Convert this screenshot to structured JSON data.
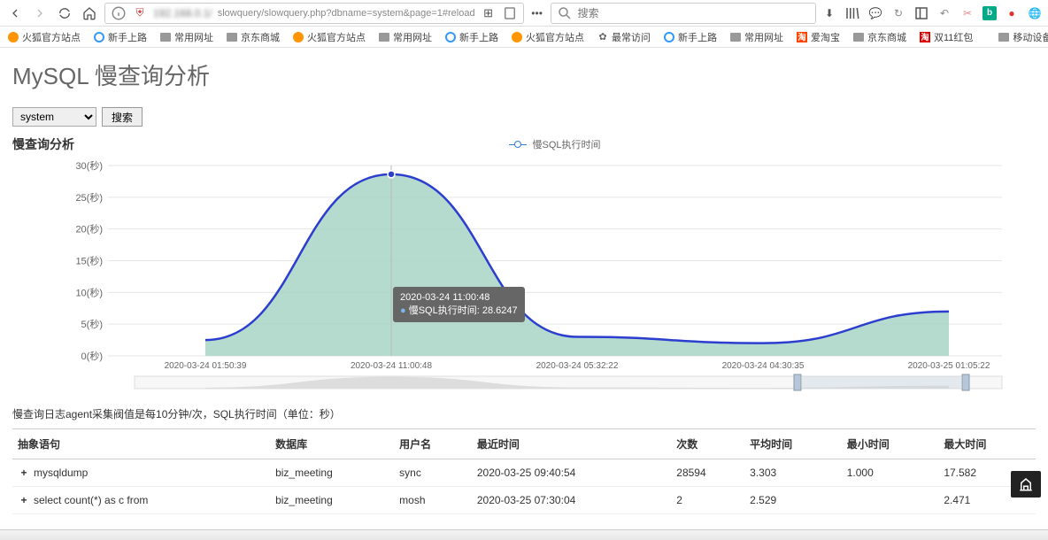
{
  "browser": {
    "url_prefix": "slowquery/slowquery.php?dbname=system&page=1#reload",
    "search_placeholder": "搜索"
  },
  "bookmarks": {
    "items": [
      {
        "label": "火狐官方站点",
        "type": "ff"
      },
      {
        "label": "新手上路",
        "type": "circle"
      },
      {
        "label": "常用网址",
        "type": "folder"
      },
      {
        "label": "京东商城",
        "type": "folder"
      },
      {
        "label": "火狐官方站点",
        "type": "ff"
      },
      {
        "label": "常用网址",
        "type": "folder"
      },
      {
        "label": "新手上路",
        "type": "circle"
      },
      {
        "label": "火狐官方站点",
        "type": "ff"
      },
      {
        "label": "最常访问",
        "type": "gear"
      },
      {
        "label": "新手上路",
        "type": "circle"
      },
      {
        "label": "常用网址",
        "type": "folder"
      },
      {
        "label": "爱淘宝",
        "type": "sq",
        "bg": "#f40"
      },
      {
        "label": "京东商城",
        "type": "folder"
      },
      {
        "label": "双11红包",
        "type": "sq",
        "bg": "#d00"
      }
    ],
    "mobile": "移动设备上的书"
  },
  "page": {
    "title": "MySQL 慢查询分析",
    "db_options": [
      "system"
    ],
    "db_selected": "system",
    "search_btn": "搜索"
  },
  "chart_data": {
    "type": "area",
    "title": "慢查询分析",
    "legend": "慢SQL执行时间",
    "ylabel_suffix": "(秒)",
    "ylim": [
      0,
      30
    ],
    "yticks": [
      0,
      5,
      10,
      15,
      20,
      25,
      30
    ],
    "x": [
      "2020-03-24 01:50:39",
      "2020-03-24 11:00:48",
      "2020-03-24 05:32:22",
      "2020-03-24 04:30:35",
      "2020-03-25 01:05:22"
    ],
    "values_at_ticks": [
      2.5,
      28.6247,
      3,
      2,
      7
    ],
    "tooltip": {
      "time": "2020-03-24 11:00:48",
      "series": "慢SQL执行时间",
      "value": "28.6247"
    }
  },
  "note": "慢查询日志agent采集阀值是每10分钟/次，SQL执行时间（单位：秒）",
  "table": {
    "headers": [
      "抽象语句",
      "数据库",
      "用户名",
      "最近时间",
      "次数",
      "平均时间",
      "最小时间",
      "最大时间"
    ],
    "rows": [
      {
        "expand": "+",
        "sql": "mysqldump",
        "db": "biz_meeting",
        "user": "sync",
        "time": "2020-03-25 09:40:54",
        "count": "28594",
        "avg": "3.303",
        "min": "1.000",
        "max": "17.582"
      },
      {
        "expand": "+",
        "sql": "select count(*) as c from",
        "db": "biz_meeting",
        "user": "mosh",
        "time": "2020-03-25 07:30:04",
        "count": "2",
        "avg": "2.529",
        "min": "",
        "max": "2.471"
      }
    ]
  }
}
